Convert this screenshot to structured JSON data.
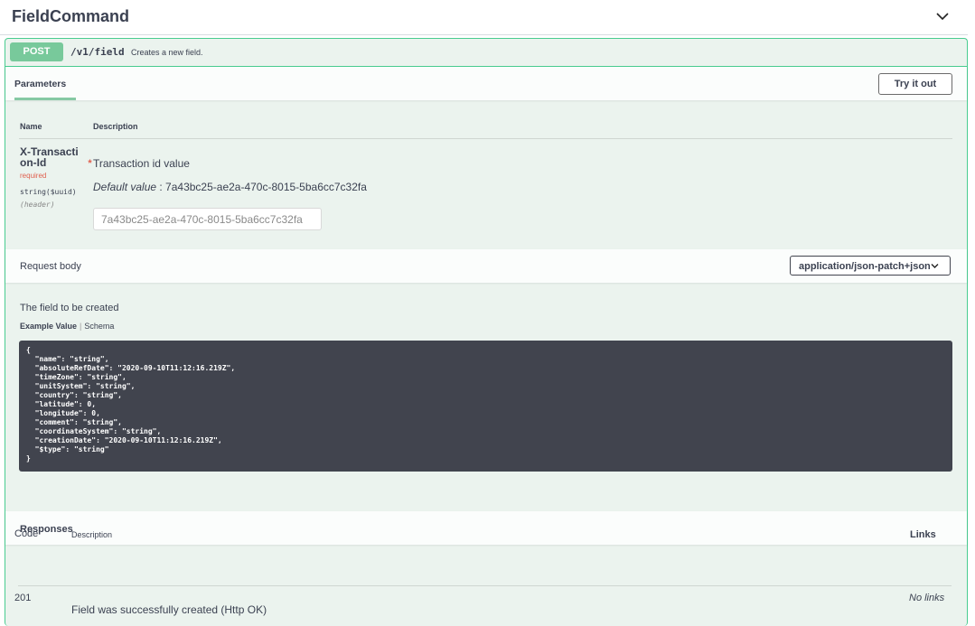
{
  "tag": {
    "title": "FieldCommand"
  },
  "operation": {
    "method": "POST",
    "path": "/v1/field",
    "summary": "Creates a new field."
  },
  "parameters": {
    "tab_label": "Parameters",
    "try_button": "Try it out",
    "col_name": "Name",
    "col_description": "Description",
    "items": [
      {
        "name": "X-Transaction-Id",
        "required_star": "*",
        "required_label": "required",
        "type": "string($uuid)",
        "location": "(header)",
        "description": "Transaction id value",
        "default_label": "Default value",
        "default_value": ": 7a43bc25-ae2a-470c-8015-5ba6cc7c32fa",
        "input_value": "7a43bc25-ae2a-470c-8015-5ba6cc7c32fa"
      }
    ]
  },
  "request_body": {
    "label": "Request body",
    "content_type": "application/json-patch+json",
    "description": "The field to be created",
    "tab_example": "Example Value",
    "tab_schema": "Schema",
    "example": "{\n  \"name\": \"string\",\n  \"absoluteRefDate\": \"2020-09-10T11:12:16.219Z\",\n  \"timeZone\": \"string\",\n  \"unitSystem\": \"string\",\n  \"country\": \"string\",\n  \"latitude\": 0,\n  \"longitude\": 0,\n  \"comment\": \"string\",\n  \"coordinateSystem\": \"string\",\n  \"creationDate\": \"2020-09-10T11:12:16.219Z\",\n  \"$type\": \"string\"\n}"
  },
  "responses": {
    "label": "Responses",
    "col_code": "Code",
    "col_description": "Description",
    "col_links": "Links",
    "rows": [
      {
        "code": "201",
        "description": "Field was successfully created (Http OK)",
        "links": "No links"
      }
    ]
  },
  "colors": {
    "accent": "#49cc90",
    "method_bg": "#78c99b",
    "block_bg": "#ebf3ee",
    "code_bg": "#41444e",
    "required": "#e0604f"
  }
}
